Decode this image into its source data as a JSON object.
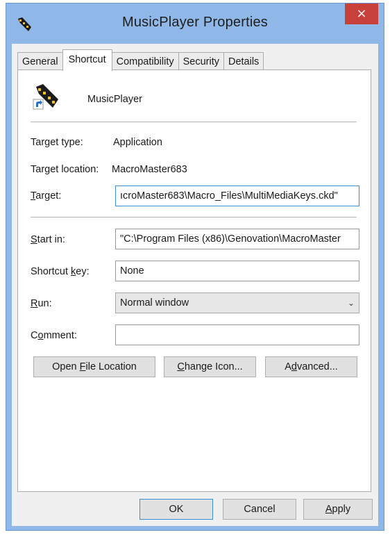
{
  "window": {
    "title": "MusicPlayer Properties",
    "close_label": "×"
  },
  "tabs": [
    {
      "label": "General",
      "active": false
    },
    {
      "label": "Shortcut",
      "active": true
    },
    {
      "label": "Compatibility",
      "active": false
    },
    {
      "label": "Security",
      "active": false
    },
    {
      "label": "Details",
      "active": false
    }
  ],
  "shortcut": {
    "app_name": "MusicPlayer",
    "target_type_label": "Target type:",
    "target_type_value": "Application",
    "target_location_label": "Target location:",
    "target_location_value": "MacroMaster683",
    "target_label_pre": "",
    "target_label_key": "T",
    "target_label_post": "arget:",
    "target_value": "ıcroMaster683\\Macro_Files\\MultiMediaKeys.ckd\"",
    "start_in_label_key": "S",
    "start_in_label_post": "tart in:",
    "start_in_value": "\"C:\\Program Files (x86)\\Genovation\\MacroMaster",
    "shortcut_key_label_pre": "Shortcut ",
    "shortcut_key_label_key": "k",
    "shortcut_key_label_post": "ey:",
    "shortcut_key_value": "None",
    "run_label_key": "R",
    "run_label_post": "un:",
    "run_value": "Normal window",
    "comment_label_pre": "C",
    "comment_label_key": "o",
    "comment_label_post": "mment:",
    "comment_value": "",
    "open_location_pre": "Open ",
    "open_location_key": "F",
    "open_location_post": "ile Location",
    "change_icon_key": "C",
    "change_icon_post": "hange Icon...",
    "advanced_pre": "A",
    "advanced_key": "d",
    "advanced_post": "vanced..."
  },
  "footer": {
    "ok_label": "OK",
    "cancel_label": "Cancel",
    "apply_key": "A",
    "apply_post": "pply"
  },
  "colors": {
    "window_frame": "#8fb8e8",
    "close_button": "#c8403a",
    "focus_border": "#3b8fd9"
  }
}
